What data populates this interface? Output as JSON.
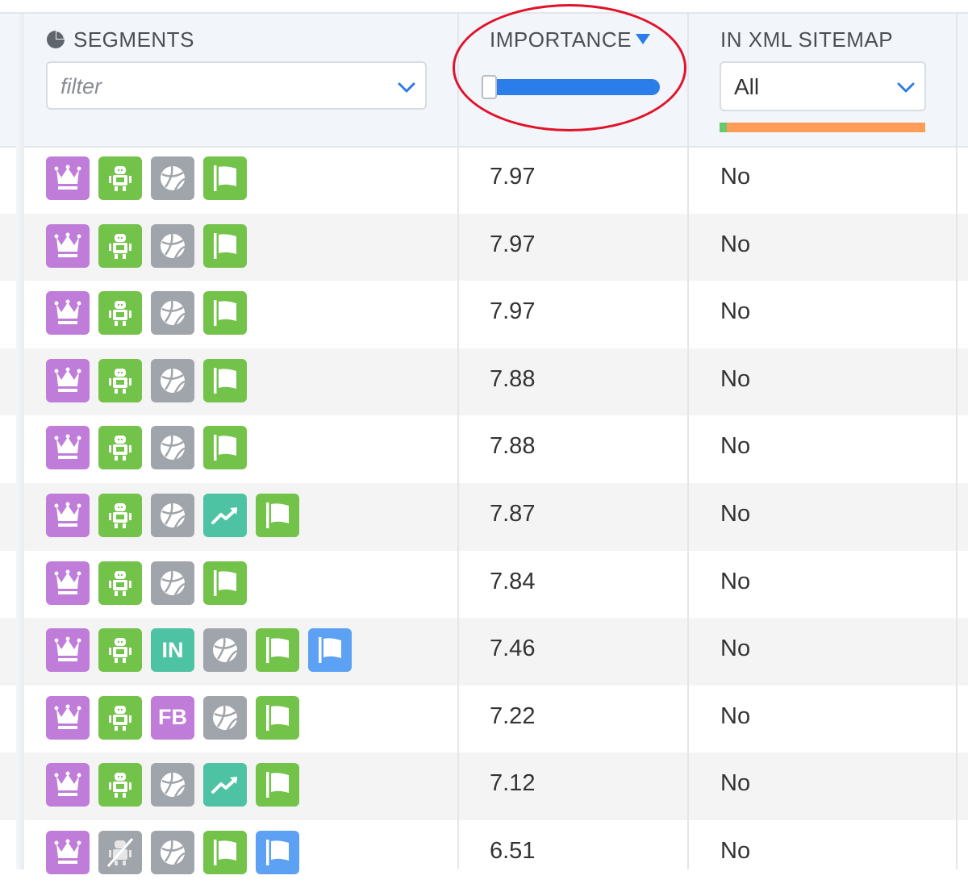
{
  "columns": {
    "segments": {
      "title": "SEGMENTS",
      "filter_placeholder": "filter",
      "icon": "pie-chart-icon"
    },
    "importance": {
      "title": "IMPORTANCE",
      "sort": "descending",
      "slider_min_fraction": 0.0,
      "slider_max_fraction": 1.0
    },
    "xml_sitemap": {
      "title": "IN XML SITEMAP",
      "selected": "All",
      "distribution": {
        "yes_fraction": 0.035,
        "no_fraction": 0.965
      }
    }
  },
  "colors": {
    "accent": "#2b7de9",
    "segment_purple": "#bf7dd9",
    "segment_green": "#73c24a",
    "segment_gray": "#a0a5ab",
    "segment_teal": "#4dc3a4",
    "segment_blue": "#5da1f4",
    "annotation_red": "#e1122a"
  },
  "rows": [
    {
      "segments": [
        {
          "type": "crown",
          "color": "purple"
        },
        {
          "type": "robot",
          "color": "green"
        },
        {
          "type": "ball",
          "color": "gray"
        },
        {
          "type": "flag",
          "color": "green"
        }
      ],
      "importance": "7.97",
      "in_xml_sitemap": "No"
    },
    {
      "segments": [
        {
          "type": "crown",
          "color": "purple"
        },
        {
          "type": "robot",
          "color": "green"
        },
        {
          "type": "ball",
          "color": "gray"
        },
        {
          "type": "flag",
          "color": "green"
        }
      ],
      "importance": "7.97",
      "in_xml_sitemap": "No"
    },
    {
      "segments": [
        {
          "type": "crown",
          "color": "purple"
        },
        {
          "type": "robot",
          "color": "green"
        },
        {
          "type": "ball",
          "color": "gray"
        },
        {
          "type": "flag",
          "color": "green"
        }
      ],
      "importance": "7.97",
      "in_xml_sitemap": "No"
    },
    {
      "segments": [
        {
          "type": "crown",
          "color": "purple"
        },
        {
          "type": "robot",
          "color": "green"
        },
        {
          "type": "ball",
          "color": "gray"
        },
        {
          "type": "flag",
          "color": "green"
        }
      ],
      "importance": "7.88",
      "in_xml_sitemap": "No"
    },
    {
      "segments": [
        {
          "type": "crown",
          "color": "purple"
        },
        {
          "type": "robot",
          "color": "green"
        },
        {
          "type": "ball",
          "color": "gray"
        },
        {
          "type": "flag",
          "color": "green"
        }
      ],
      "importance": "7.88",
      "in_xml_sitemap": "No"
    },
    {
      "segments": [
        {
          "type": "crown",
          "color": "purple"
        },
        {
          "type": "robot",
          "color": "green"
        },
        {
          "type": "ball",
          "color": "gray"
        },
        {
          "type": "trend",
          "color": "teal"
        },
        {
          "type": "flag",
          "color": "green"
        }
      ],
      "importance": "7.87",
      "in_xml_sitemap": "No"
    },
    {
      "segments": [
        {
          "type": "crown",
          "color": "purple"
        },
        {
          "type": "robot",
          "color": "green"
        },
        {
          "type": "ball",
          "color": "gray"
        },
        {
          "type": "flag",
          "color": "green"
        }
      ],
      "importance": "7.84",
      "in_xml_sitemap": "No"
    },
    {
      "segments": [
        {
          "type": "crown",
          "color": "purple"
        },
        {
          "type": "robot",
          "color": "green"
        },
        {
          "type": "text",
          "label": "IN",
          "color": "teal"
        },
        {
          "type": "ball",
          "color": "gray"
        },
        {
          "type": "flag",
          "color": "green"
        },
        {
          "type": "flag",
          "color": "blue"
        }
      ],
      "importance": "7.46",
      "in_xml_sitemap": "No"
    },
    {
      "segments": [
        {
          "type": "crown",
          "color": "purple"
        },
        {
          "type": "robot",
          "color": "green"
        },
        {
          "type": "text",
          "label": "FB",
          "color": "purple"
        },
        {
          "type": "ball",
          "color": "gray"
        },
        {
          "type": "flag",
          "color": "green"
        }
      ],
      "importance": "7.22",
      "in_xml_sitemap": "No"
    },
    {
      "segments": [
        {
          "type": "crown",
          "color": "purple"
        },
        {
          "type": "robot",
          "color": "green"
        },
        {
          "type": "ball",
          "color": "gray"
        },
        {
          "type": "trend",
          "color": "teal"
        },
        {
          "type": "flag",
          "color": "green"
        }
      ],
      "importance": "7.12",
      "in_xml_sitemap": "No"
    },
    {
      "segments": [
        {
          "type": "crown",
          "color": "purple"
        },
        {
          "type": "robot-off",
          "color": "gray"
        },
        {
          "type": "ball",
          "color": "gray"
        },
        {
          "type": "flag",
          "color": "green"
        },
        {
          "type": "flag",
          "color": "blue"
        }
      ],
      "importance": "6.51",
      "in_xml_sitemap": "No"
    }
  ]
}
